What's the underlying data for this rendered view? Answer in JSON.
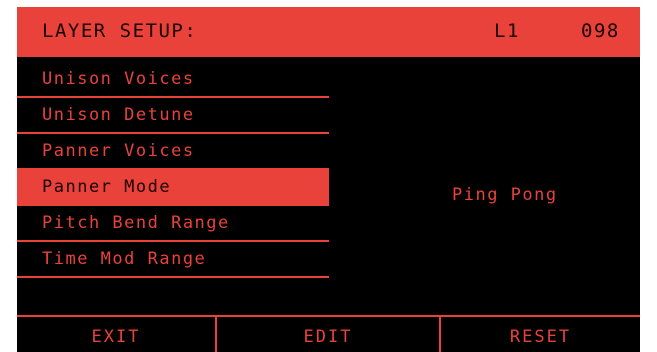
{
  "header": {
    "title": "LAYER SETUP:",
    "layer": "L1",
    "preset": "098"
  },
  "menu": {
    "items": [
      {
        "label": "Unison Voices"
      },
      {
        "label": "Unison Detune"
      },
      {
        "label": "Panner Voices"
      },
      {
        "label": "Panner Mode"
      },
      {
        "label": "Pitch Bend Range"
      },
      {
        "label": "Time Mod Range"
      }
    ],
    "selected_index": 3
  },
  "value": {
    "current": "Ping Pong"
  },
  "footer": {
    "exit_label": "EXIT",
    "edit_label": "EDIT",
    "reset_label": "RESET"
  },
  "colors": {
    "accent": "#e8423a",
    "background": "#000000",
    "dark_text": "#1a0000"
  }
}
